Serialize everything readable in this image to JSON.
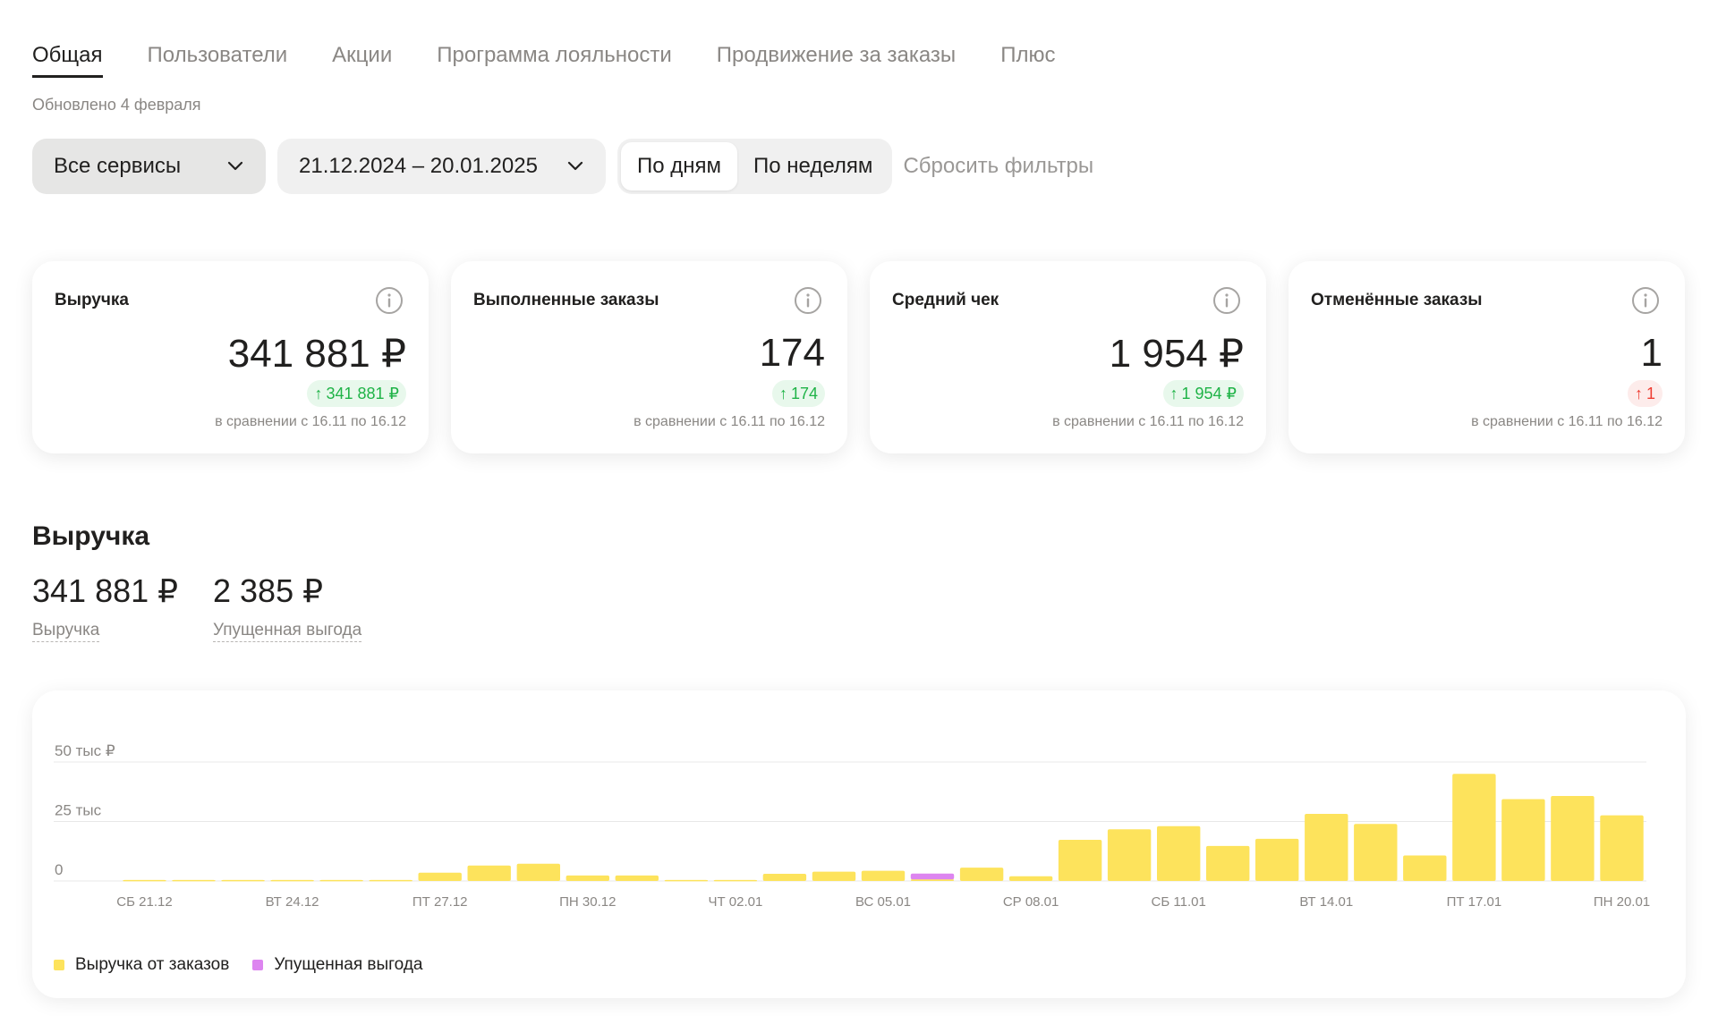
{
  "tabs": [
    {
      "label": "Общая",
      "active": true
    },
    {
      "label": "Пользователи",
      "active": false
    },
    {
      "label": "Акции",
      "active": false
    },
    {
      "label": "Программа лояльности",
      "active": false
    },
    {
      "label": "Продвижение за заказы",
      "active": false
    },
    {
      "label": "Плюс",
      "active": false
    }
  ],
  "updated_text": "Обновлено 4 февраля",
  "filters": {
    "services_label": "Все сервисы",
    "date_range": "21.12.2024 – 20.01.2025",
    "by_days": "По дням",
    "by_weeks": "По неделям",
    "active_period": "По дням",
    "reset": "Сбросить фильтры"
  },
  "cards": [
    {
      "title": "Выручка",
      "value": "341 881 ₽",
      "delta": "341 881 ₽",
      "delta_dir": "up",
      "delta_tone": "good",
      "compare": "в сравнении с 16.11 по 16.12"
    },
    {
      "title": "Выполненные заказы",
      "value": "174",
      "delta": "174",
      "delta_dir": "up",
      "delta_tone": "good",
      "compare": "в сравнении с 16.11 по 16.12"
    },
    {
      "title": "Средний чек",
      "value": "1 954 ₽",
      "delta": "1 954 ₽",
      "delta_dir": "up",
      "delta_tone": "good",
      "compare": "в сравнении с 16.11 по 16.12"
    },
    {
      "title": "Отменённые заказы",
      "value": "1",
      "delta": "1",
      "delta_dir": "up",
      "delta_tone": "bad",
      "compare": "в сравнении с 16.11 по 16.12"
    }
  ],
  "revenue_section": {
    "title": "Выручка",
    "revenue_value": "341 881 ₽",
    "revenue_label": "Выручка",
    "lost_value": "2 385 ₽",
    "lost_label": "Упущенная выгода"
  },
  "colors": {
    "revenue_bar": "#fde35c",
    "lost_bar": "#dd85f0",
    "grid": "#e8e8e8",
    "good": "#1fb347",
    "bad": "#ef3d32"
  },
  "chart_data": {
    "type": "bar",
    "stacked": true,
    "y_tick_labels": [
      "0",
      "25 тыс",
      "50 тыс ₽"
    ],
    "y_ticks": [
      0,
      25000,
      50000
    ],
    "ylim": [
      0,
      50000
    ],
    "x_tick_labels": [
      "СБ 21.12",
      "ВТ 24.12",
      "ПТ 27.12",
      "ПН 30.12",
      "ЧТ 02.01",
      "ВС 05.01",
      "СР 08.01",
      "СБ 11.01",
      "ВТ 14.01",
      "ПТ 17.01",
      "ПН 20.01"
    ],
    "categories": [
      "21.12",
      "22.12",
      "23.12",
      "24.12",
      "25.12",
      "26.12",
      "27.12",
      "28.12",
      "29.12",
      "30.12",
      "31.12",
      "01.01",
      "02.01",
      "03.01",
      "04.01",
      "05.01",
      "06.01",
      "07.01",
      "08.01",
      "09.01",
      "10.01",
      "11.01",
      "12.01",
      "13.01",
      "14.01",
      "15.01",
      "16.01",
      "17.01",
      "18.01",
      "19.01",
      "20.01"
    ],
    "series": [
      {
        "name": "Выручка от заказов",
        "values": [
          400,
          400,
          400,
          400,
          400,
          400,
          3500,
          6500,
          7200,
          2300,
          2300,
          400,
          400,
          3000,
          3900,
          4300,
          700,
          5600,
          2000,
          17300,
          21700,
          23000,
          14700,
          17700,
          28200,
          24000,
          10700,
          45000,
          34400,
          35700,
          27600
        ]
      },
      {
        "name": "Упущенная выгода",
        "values": [
          0,
          0,
          0,
          0,
          0,
          0,
          0,
          0,
          0,
          0,
          0,
          0,
          0,
          0,
          0,
          0,
          2400,
          0,
          0,
          0,
          0,
          0,
          0,
          0,
          0,
          0,
          0,
          0,
          0,
          0,
          0
        ]
      }
    ],
    "legend_position": "bottom-left",
    "grid": true
  }
}
